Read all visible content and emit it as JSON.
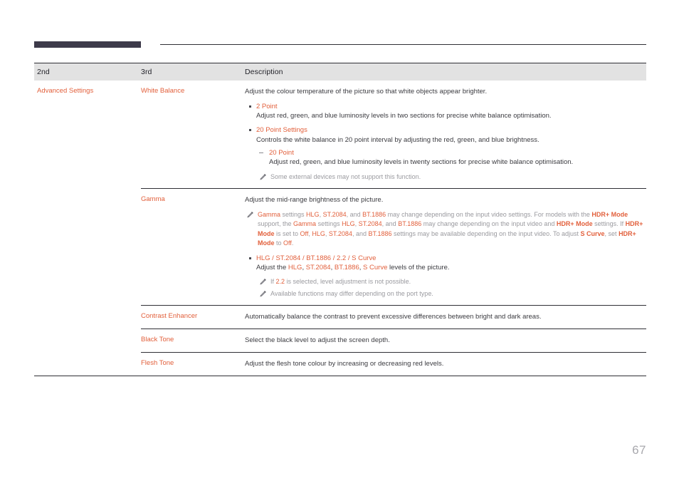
{
  "document": {
    "page_number": "67",
    "accent_color": "#e2603c",
    "header_bar_color": "#3d3a4a",
    "table_header_bg": "#e2e2e2",
    "note_color": "#9a9a9f"
  },
  "table": {
    "columns": [
      "2nd",
      "3rd",
      "Description"
    ],
    "rows": [
      {
        "col2": "Advanced Settings",
        "col3": "White Balance",
        "description": {
          "intro": "Adjust the colour temperature of the picture so that white objects appear brighter.",
          "bullets": [
            {
              "title": "2 Point",
              "body": "Adjust red, green, and blue luminosity levels in two sections for precise white balance optimisation."
            },
            {
              "title": "20 Point Settings",
              "body": "Controls the white balance in 20 point interval by adjusting the red, green, and blue brightness.",
              "subbullets": [
                {
                  "title": "20 Point",
                  "body": "Adjust red, green, and blue luminosity levels in twenty sections for precise white balance optimisation."
                }
              ]
            }
          ],
          "notes": [
            "Some external devices may not support this function."
          ]
        }
      },
      {
        "col2": "",
        "col3": "Gamma",
        "description": {
          "intro": "Adjust the mid-range brightness of the picture.",
          "top_note_segments": [
            {
              "t": "Gamma",
              "s": "k"
            },
            {
              "t": " settings ",
              "s": "n"
            },
            {
              "t": "HLG",
              "s": "k"
            },
            {
              "t": ", ",
              "s": "n"
            },
            {
              "t": "ST.2084",
              "s": "k"
            },
            {
              "t": ", and ",
              "s": "n"
            },
            {
              "t": "BT.1886",
              "s": "k"
            },
            {
              "t": " may change depending on the input video settings. For models with the ",
              "s": "n"
            },
            {
              "t": "HDR+ Mode",
              "s": "kb"
            },
            {
              "t": " support, the ",
              "s": "n"
            },
            {
              "t": "Gamma",
              "s": "k"
            },
            {
              "t": " settings ",
              "s": "n"
            },
            {
              "t": "HLG",
              "s": "k"
            },
            {
              "t": ", ",
              "s": "n"
            },
            {
              "t": "ST.2084",
              "s": "k"
            },
            {
              "t": ", and ",
              "s": "n"
            },
            {
              "t": "BT.1886",
              "s": "k"
            },
            {
              "t": " may change depending on the input video and ",
              "s": "n"
            },
            {
              "t": "HDR+ Mode",
              "s": "kb"
            },
            {
              "t": " settings. If ",
              "s": "n"
            },
            {
              "t": "HDR+ Mode",
              "s": "kb"
            },
            {
              "t": " is set to ",
              "s": "n"
            },
            {
              "t": "Off",
              "s": "k"
            },
            {
              "t": ", ",
              "s": "n"
            },
            {
              "t": "HLG",
              "s": "k"
            },
            {
              "t": ", ",
              "s": "n"
            },
            {
              "t": "ST.2084",
              "s": "k"
            },
            {
              "t": ", and ",
              "s": "n"
            },
            {
              "t": "BT.1886",
              "s": "k"
            },
            {
              "t": " settings may be available depending on the input video. To adjust ",
              "s": "n"
            },
            {
              "t": "S Curve",
              "s": "kb"
            },
            {
              "t": ", set ",
              "s": "n"
            },
            {
              "t": "HDR+ Mode",
              "s": "kb"
            },
            {
              "t": " to ",
              "s": "n"
            },
            {
              "t": "Off",
              "s": "k"
            },
            {
              "t": ".",
              "s": "n"
            }
          ],
          "bullets": [
            {
              "title": "HLG / ST.2084 / BT.1886 / 2.2 / S Curve",
              "body_segments": [
                {
                  "t": "Adjust the ",
                  "s": "n"
                },
                {
                  "t": "HLG",
                  "s": "k"
                },
                {
                  "t": ", ",
                  "s": "n"
                },
                {
                  "t": "ST.2084",
                  "s": "k"
                },
                {
                  "t": ", ",
                  "s": "n"
                },
                {
                  "t": "BT.1886",
                  "s": "k"
                },
                {
                  "t": ", ",
                  "s": "n"
                },
                {
                  "t": "S Curve",
                  "s": "k"
                },
                {
                  "t": " levels of the picture.",
                  "s": "n"
                }
              ]
            }
          ],
          "indent_notes": [
            [
              {
                "t": "If ",
                "s": "n"
              },
              {
                "t": "2.2",
                "s": "k"
              },
              {
                "t": " is selected, level adjustment is not possible.",
                "s": "n"
              }
            ],
            [
              {
                "t": "Available functions may differ depending on the port type.",
                "s": "n"
              }
            ]
          ]
        }
      },
      {
        "col2": "",
        "col3": "Contrast Enhancer",
        "description": {
          "intro": "Automatically balance the contrast to prevent excessive differences between bright and dark areas."
        }
      },
      {
        "col2": "",
        "col3": "Black Tone",
        "description": {
          "intro": "Select the black level to adjust the screen depth."
        }
      },
      {
        "col2": "",
        "col3": "Flesh Tone",
        "description": {
          "intro": "Adjust the flesh tone colour by increasing or decreasing red levels."
        }
      }
    ]
  }
}
